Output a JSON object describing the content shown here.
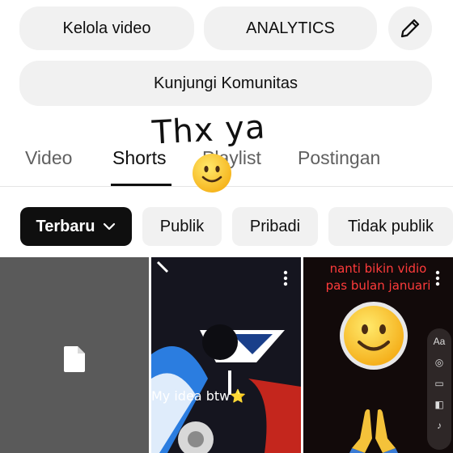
{
  "actions": {
    "manage_videos": "Kelola video",
    "analytics": "ANALYTICS",
    "edit_icon": "pencil-icon",
    "visit_community": "Kunjungi Komunitas"
  },
  "overlay": {
    "handwritten": "Thx ya",
    "sticker": "slightly-smiling-face"
  },
  "tabs": [
    {
      "label": "Video",
      "active": false
    },
    {
      "label": "Shorts",
      "active": true
    },
    {
      "label": "Playlist",
      "active": false
    },
    {
      "label": "Postingan",
      "active": false
    }
  ],
  "filters": [
    {
      "label": "Terbaru",
      "selected": true,
      "icon": "chevron-down-icon"
    },
    {
      "label": "Publik",
      "selected": false
    },
    {
      "label": "Pribadi",
      "selected": false
    },
    {
      "label": "Tidak publik",
      "selected": false
    }
  ],
  "shorts": [
    {
      "thumbnail": "document-placeholder-icon"
    },
    {
      "caption": "My idea btw⭐",
      "menu_icon": "more-vert-icon"
    },
    {
      "caption_line1": "nanti bikin vidio",
      "caption_line2": "pas bulan januari",
      "menu_icon": "more-vert-icon",
      "emoji": "slightly-smiling-face",
      "emoji2": "folded-hands"
    }
  ],
  "colors": {
    "chip_selected_bg": "#0f0f0f",
    "chip_bg": "#f1f1f1",
    "caption_red": "#ff3b3b"
  }
}
